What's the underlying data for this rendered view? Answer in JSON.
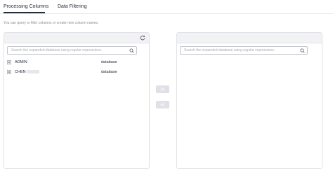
{
  "tabs": [
    {
      "label": "Processing Columns",
      "active": true
    },
    {
      "label": "Data Filtering",
      "active": false
    }
  ],
  "hint": "You can query or filter columns or create new column names.",
  "left_panel": {
    "search_placeholder": "Search the expanded database using regular expressions.",
    "items": [
      {
        "name": "ADMIN",
        "type": "database"
      },
      {
        "name": "CHEN",
        "type": "database"
      }
    ]
  },
  "right_panel": {
    "search_placeholder": "Search the expanded database using regular expressions."
  },
  "icons": {
    "refresh": "refresh-icon",
    "search": "search-icon",
    "expand": "plus-square-icon",
    "move_right": "double-chevron-right-icon",
    "move_left": "double-chevron-left-icon"
  },
  "colors": {
    "text": "#252b3a",
    "muted": "#8a8e99",
    "border": "#dfe1e6",
    "panel_header": "#f2f2f4"
  }
}
